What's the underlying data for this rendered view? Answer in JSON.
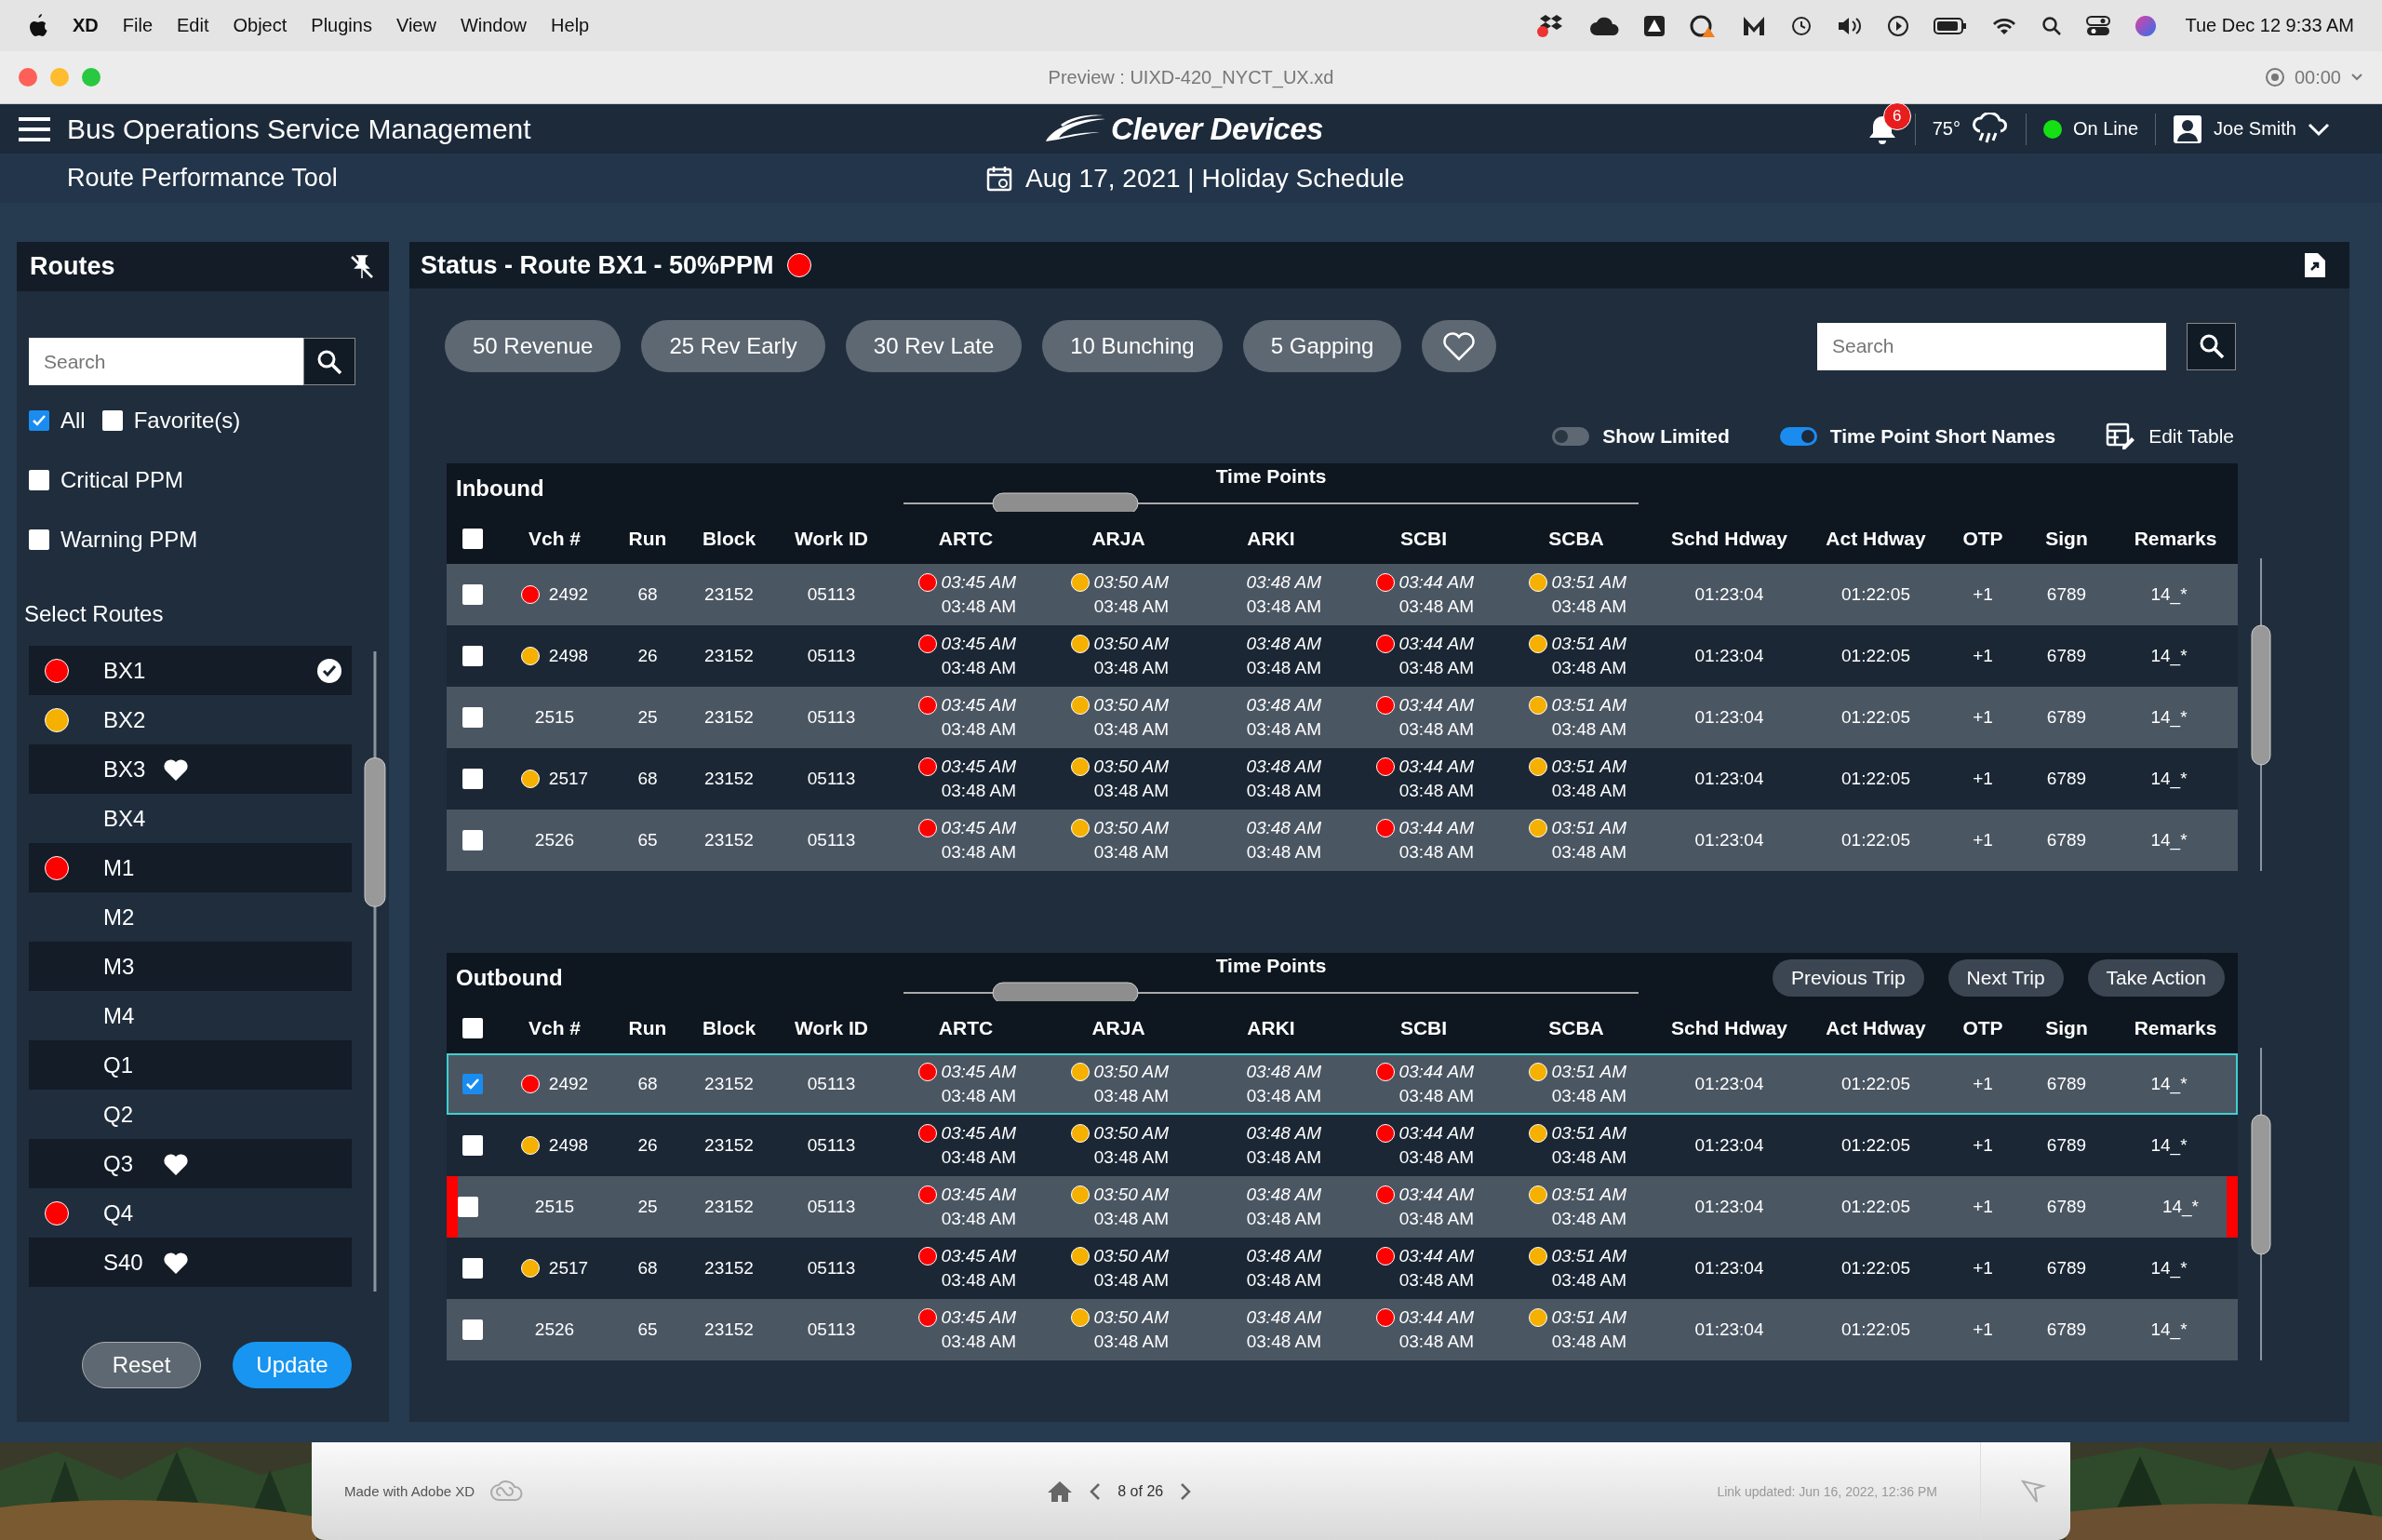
{
  "menu_bar": {
    "app": "XD",
    "items": [
      "File",
      "Edit",
      "Object",
      "Plugins",
      "View",
      "Window",
      "Help"
    ],
    "clock": "Tue Dec 12  9:33 AM"
  },
  "window": {
    "title": "Preview : UIXD-420_NYCT_UX.xd",
    "timer": "00:00"
  },
  "header": {
    "title": "Bus Operations Service Management",
    "brand": "Clever Devices",
    "notifications": "6",
    "temperature": "75°",
    "status": "On Line",
    "user": "Joe Smith",
    "subtitle": "Route Performance Tool",
    "date": "Aug 17, 2021 | Holiday Schedule"
  },
  "sidebar": {
    "title": "Routes",
    "search": {
      "placeholder": "Search"
    },
    "filters": [
      {
        "label": "All",
        "checked": true
      },
      {
        "label": "Favorite(s)",
        "checked": false
      },
      {
        "label": "Critical PPM",
        "checked": false
      },
      {
        "label": "Warning PPM",
        "checked": false
      }
    ],
    "list_title": "Select Routes",
    "routes": [
      {
        "name": "BX1",
        "color": "#ff0000",
        "favorite": false,
        "selected": true
      },
      {
        "name": "BX2",
        "color": "#f5b000",
        "favorite": false,
        "selected": false
      },
      {
        "name": "BX3",
        "favorite": true,
        "selected": false
      },
      {
        "name": "BX4",
        "favorite": false,
        "selected": false
      },
      {
        "name": "M1",
        "color": "#ff0000",
        "favorite": false,
        "selected": false
      },
      {
        "name": "M2",
        "favorite": false,
        "selected": false
      },
      {
        "name": "M3",
        "favorite": false,
        "selected": false
      },
      {
        "name": "M4",
        "favorite": false,
        "selected": false
      },
      {
        "name": "Q1",
        "favorite": false,
        "selected": false
      },
      {
        "name": "Q2",
        "favorite": false,
        "selected": false
      },
      {
        "name": "Q3",
        "favorite": true,
        "selected": false
      },
      {
        "name": "Q4",
        "color": "#ff0000",
        "favorite": false,
        "selected": false
      },
      {
        "name": "S40",
        "favorite": true,
        "selected": false
      }
    ],
    "buttons": [
      "Reset",
      "Update"
    ]
  },
  "status": {
    "title": "Status - Route BX1 - 50%PPM",
    "color": "#ff0000",
    "filters": [
      "50 Revenue",
      "25 Rev Early",
      "30 Rev Late",
      "10 Bunching",
      "5 Gapping"
    ],
    "search": {
      "placeholder": "Search"
    },
    "toggles": [
      {
        "label": "Show Limited",
        "on": false
      },
      {
        "label": "Time Point Short Names",
        "on": true
      }
    ],
    "edit_table": "Edit Table"
  },
  "tables": [
    {
      "title": "Inbound",
      "group": "Time Points",
      "header_checked": false,
      "columns": [
        "Vch #",
        "Run",
        "Block",
        "Work ID",
        "ARTC",
        "ARJA",
        "ARKI",
        "SCBI",
        "SCBA",
        "Schd Hdway",
        "Act Hdway",
        "OTP",
        "Sign",
        "Remarks"
      ],
      "rows": [
        {
          "selected": false,
          "alert": false,
          "color": "#ff0000",
          "vch": "2492",
          "run": "68",
          "block": "23152",
          "work_id": "05113",
          "times": [
            {
              "color": "#ff0000",
              "sched": "03:45 AM",
              "actual": "03:48 AM"
            },
            {
              "color": "#f5b000",
              "sched": "03:50 AM",
              "actual": "03:48 AM"
            },
            {
              "sched": "03:48 AM",
              "actual": "03:48 AM"
            },
            {
              "color": "#ff0000",
              "sched": "03:44 AM",
              "actual": "03:48 AM"
            },
            {
              "color": "#f5b000",
              "sched": "03:51 AM",
              "actual": "03:48 AM"
            }
          ],
          "schd": "01:23:04",
          "act": "01:22:05",
          "otp": "+1",
          "sign": "6789",
          "remarks": "14_*"
        },
        {
          "selected": false,
          "alert": false,
          "color": "#f5b000",
          "vch": "2498",
          "run": "26",
          "block": "23152",
          "work_id": "05113",
          "times": [
            {
              "color": "#ff0000",
              "sched": "03:45 AM",
              "actual": "03:48 AM"
            },
            {
              "color": "#f5b000",
              "sched": "03:50 AM",
              "actual": "03:48 AM"
            },
            {
              "sched": "03:48 AM",
              "actual": "03:48 AM"
            },
            {
              "color": "#ff0000",
              "sched": "03:44 AM",
              "actual": "03:48 AM"
            },
            {
              "color": "#f5b000",
              "sched": "03:51 AM",
              "actual": "03:48 AM"
            }
          ],
          "schd": "01:23:04",
          "act": "01:22:05",
          "otp": "+1",
          "sign": "6789",
          "remarks": "14_*"
        },
        {
          "selected": false,
          "alert": false,
          "vch": "2515",
          "run": "25",
          "block": "23152",
          "work_id": "05113",
          "times": [
            {
              "color": "#ff0000",
              "sched": "03:45 AM",
              "actual": "03:48 AM"
            },
            {
              "color": "#f5b000",
              "sched": "03:50 AM",
              "actual": "03:48 AM"
            },
            {
              "sched": "03:48 AM",
              "actual": "03:48 AM"
            },
            {
              "color": "#ff0000",
              "sched": "03:44 AM",
              "actual": "03:48 AM"
            },
            {
              "color": "#f5b000",
              "sched": "03:51 AM",
              "actual": "03:48 AM"
            }
          ],
          "schd": "01:23:04",
          "act": "01:22:05",
          "otp": "+1",
          "sign": "6789",
          "remarks": "14_*"
        },
        {
          "selected": false,
          "alert": false,
          "color": "#f5b000",
          "vch": "2517",
          "run": "68",
          "block": "23152",
          "work_id": "05113",
          "times": [
            {
              "color": "#ff0000",
              "sched": "03:45 AM",
              "actual": "03:48 AM"
            },
            {
              "color": "#f5b000",
              "sched": "03:50 AM",
              "actual": "03:48 AM"
            },
            {
              "sched": "03:48 AM",
              "actual": "03:48 AM"
            },
            {
              "color": "#ff0000",
              "sched": "03:44 AM",
              "actual": "03:48 AM"
            },
            {
              "color": "#f5b000",
              "sched": "03:51 AM",
              "actual": "03:48 AM"
            }
          ],
          "schd": "01:23:04",
          "act": "01:22:05",
          "otp": "+1",
          "sign": "6789",
          "remarks": "14_*"
        },
        {
          "selected": false,
          "alert": false,
          "vch": "2526",
          "run": "65",
          "block": "23152",
          "work_id": "05113",
          "times": [
            {
              "color": "#ff0000",
              "sched": "03:45 AM",
              "actual": "03:48 AM"
            },
            {
              "color": "#f5b000",
              "sched": "03:50 AM",
              "actual": "03:48 AM"
            },
            {
              "sched": "03:48 AM",
              "actual": "03:48 AM"
            },
            {
              "color": "#ff0000",
              "sched": "03:44 AM",
              "actual": "03:48 AM"
            },
            {
              "color": "#f5b000",
              "sched": "03:51 AM",
              "actual": "03:48 AM"
            }
          ],
          "schd": "01:23:04",
          "act": "01:22:05",
          "otp": "+1",
          "sign": "6789",
          "remarks": "14_*"
        }
      ]
    },
    {
      "title": "Outbound",
      "group": "Time Points",
      "actions": [
        "Previous Trip",
        "Next Trip",
        "Take Action"
      ],
      "header_checked": false,
      "columns": [
        "Vch #",
        "Run",
        "Block",
        "Work ID",
        "ARTC",
        "ARJA",
        "ARKI",
        "SCBI",
        "SCBA",
        "Schd Hdway",
        "Act Hdway",
        "OTP",
        "Sign",
        "Remarks"
      ],
      "rows": [
        {
          "selected": true,
          "alert": false,
          "color": "#ff0000",
          "vch": "2492",
          "run": "68",
          "block": "23152",
          "work_id": "05113",
          "times": [
            {
              "color": "#ff0000",
              "sched": "03:45 AM",
              "actual": "03:48 AM"
            },
            {
              "color": "#f5b000",
              "sched": "03:50 AM",
              "actual": "03:48 AM"
            },
            {
              "sched": "03:48 AM",
              "actual": "03:48 AM"
            },
            {
              "color": "#ff0000",
              "sched": "03:44 AM",
              "actual": "03:48 AM"
            },
            {
              "color": "#f5b000",
              "sched": "03:51 AM",
              "actual": "03:48 AM"
            }
          ],
          "schd": "01:23:04",
          "act": "01:22:05",
          "otp": "+1",
          "sign": "6789",
          "remarks": "14_*"
        },
        {
          "selected": false,
          "alert": false,
          "color": "#f5b000",
          "vch": "2498",
          "run": "26",
          "block": "23152",
          "work_id": "05113",
          "times": [
            {
              "color": "#ff0000",
              "sched": "03:45 AM",
              "actual": "03:48 AM"
            },
            {
              "color": "#f5b000",
              "sched": "03:50 AM",
              "actual": "03:48 AM"
            },
            {
              "sched": "03:48 AM",
              "actual": "03:48 AM"
            },
            {
              "color": "#ff0000",
              "sched": "03:44 AM",
              "actual": "03:48 AM"
            },
            {
              "color": "#f5b000",
              "sched": "03:51 AM",
              "actual": "03:48 AM"
            }
          ],
          "schd": "01:23:04",
          "act": "01:22:05",
          "otp": "+1",
          "sign": "6789",
          "remarks": "14_*"
        },
        {
          "selected": false,
          "alert": true,
          "vch": "2515",
          "run": "25",
          "block": "23152",
          "work_id": "05113",
          "times": [
            {
              "color": "#ff0000",
              "sched": "03:45 AM",
              "actual": "03:48 AM"
            },
            {
              "color": "#f5b000",
              "sched": "03:50 AM",
              "actual": "03:48 AM"
            },
            {
              "sched": "03:48 AM",
              "actual": "03:48 AM"
            },
            {
              "color": "#ff0000",
              "sched": "03:44 AM",
              "actual": "03:48 AM"
            },
            {
              "color": "#f5b000",
              "sched": "03:51 AM",
              "actual": "03:48 AM"
            }
          ],
          "schd": "01:23:04",
          "act": "01:22:05",
          "otp": "+1",
          "sign": "6789",
          "remarks": "14_*"
        },
        {
          "selected": false,
          "alert": false,
          "color": "#f5b000",
          "vch": "2517",
          "run": "68",
          "block": "23152",
          "work_id": "05113",
          "times": [
            {
              "color": "#ff0000",
              "sched": "03:45 AM",
              "actual": "03:48 AM"
            },
            {
              "color": "#f5b000",
              "sched": "03:50 AM",
              "actual": "03:48 AM"
            },
            {
              "sched": "03:48 AM",
              "actual": "03:48 AM"
            },
            {
              "color": "#ff0000",
              "sched": "03:44 AM",
              "actual": "03:48 AM"
            },
            {
              "color": "#f5b000",
              "sched": "03:51 AM",
              "actual": "03:48 AM"
            }
          ],
          "schd": "01:23:04",
          "act": "01:22:05",
          "otp": "+1",
          "sign": "6789",
          "remarks": "14_*"
        },
        {
          "selected": false,
          "alert": false,
          "vch": "2526",
          "run": "65",
          "block": "23152",
          "work_id": "05113",
          "times": [
            {
              "color": "#ff0000",
              "sched": "03:45 AM",
              "actual": "03:48 AM"
            },
            {
              "color": "#f5b000",
              "sched": "03:50 AM",
              "actual": "03:48 AM"
            },
            {
              "sched": "03:48 AM",
              "actual": "03:48 AM"
            },
            {
              "color": "#ff0000",
              "sched": "03:44 AM",
              "actual": "03:48 AM"
            },
            {
              "color": "#f5b000",
              "sched": "03:51 AM",
              "actual": "03:48 AM"
            }
          ],
          "schd": "01:23:04",
          "act": "01:22:05",
          "otp": "+1",
          "sign": "6789",
          "remarks": "14_*"
        }
      ]
    }
  ],
  "footer": {
    "made_with": "Made with Adobe XD",
    "page": "8 of 26",
    "updated": "Link updated: Jun 16, 2022, 12:36 PM"
  }
}
